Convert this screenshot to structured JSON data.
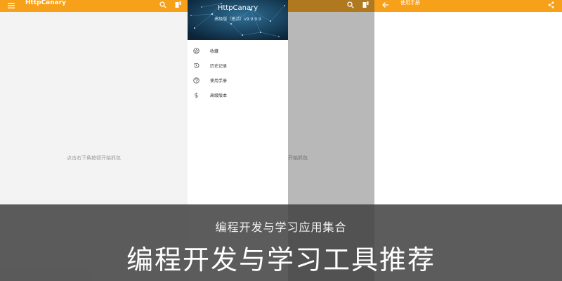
{
  "screen1": {
    "app_title": "HttpCanary",
    "empty_hint": "点击右下角按钮开始抓包"
  },
  "screen2": {
    "drawer_title": "HttpCanary",
    "drawer_subtitle": "高级版（激活）v9.9.9.9",
    "empty_hint_tail": "开始抓包",
    "menu": [
      {
        "label": "收藏",
        "icon": "star-circle-icon"
      },
      {
        "label": "历史记录",
        "icon": "history-icon"
      },
      {
        "label": "使用手册",
        "icon": "help-circle-icon"
      },
      {
        "label": "高级版本",
        "icon": "dollar-icon"
      }
    ]
  },
  "screen3": {
    "title": "使用手册"
  },
  "banner": {
    "subtitle": "编程开发与学习应用集合",
    "title": "编程开发与学习工具推荐"
  },
  "colors": {
    "accent": "#f7a01a",
    "accent_dimmed": "#b0791f",
    "drawer_header": "#0e2e48",
    "overlay": "#414141"
  }
}
